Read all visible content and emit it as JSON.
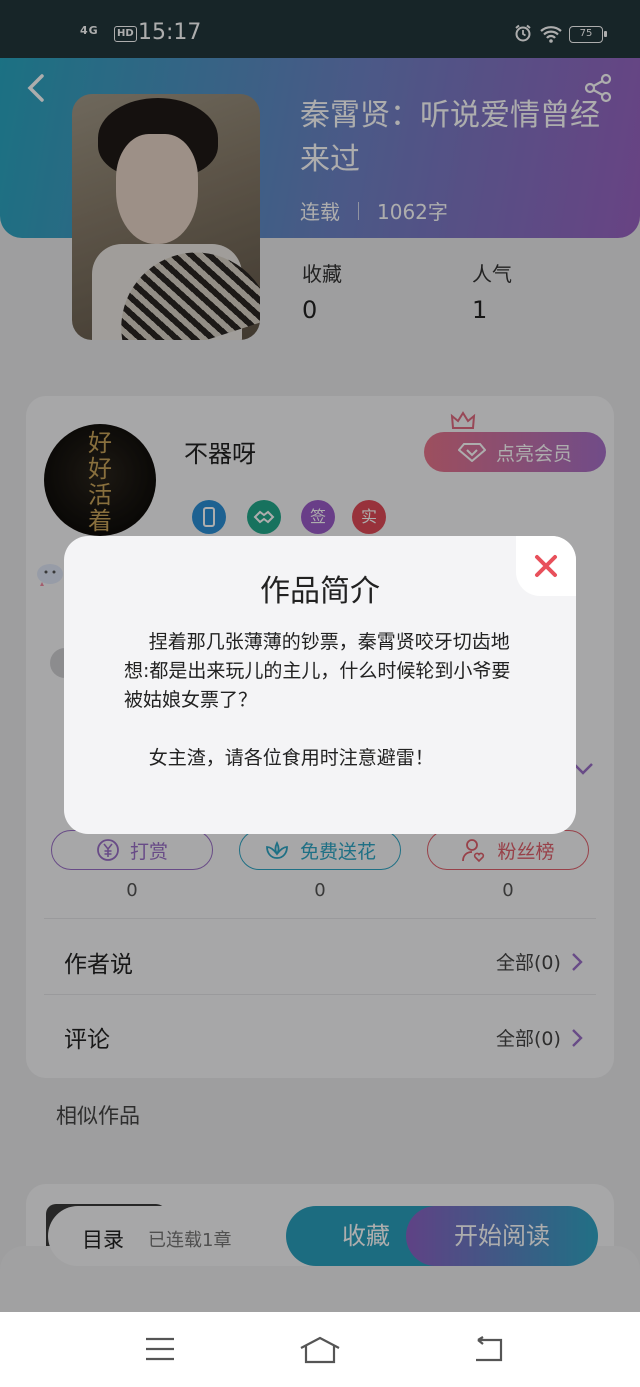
{
  "status_bar": {
    "network": "4G",
    "hd": "HD",
    "time": "15:17",
    "battery": "75"
  },
  "book": {
    "title": "秦霄贤：听说爱情曾经来过",
    "status": "连载",
    "word_count": "1062字",
    "stats": [
      {
        "label": "收藏",
        "value": "0"
      },
      {
        "label": "人气",
        "value": "1"
      }
    ]
  },
  "author": {
    "name": "不器呀",
    "avatar_text": "好好活着",
    "badges": [
      {
        "icon": "phone-badge-icon",
        "text": "",
        "color": "#2b8fd6"
      },
      {
        "icon": "handshake-badge-icon",
        "text": "",
        "color": "#23a98b"
      },
      {
        "icon": "sign-badge-icon",
        "text": "签",
        "color": "#9b5cc9"
      },
      {
        "icon": "real-badge-icon",
        "text": "实",
        "color": "#e04b57"
      }
    ],
    "vip_label": "点亮会员"
  },
  "actions": [
    {
      "label": "打赏",
      "count": "0",
      "color": "#9a6fc7"
    },
    {
      "label": "免费送花",
      "count": "0",
      "color": "#2ea5c4"
    },
    {
      "label": "粉丝榜",
      "count": "0",
      "color": "#e0606c"
    }
  ],
  "sections": {
    "author_says": {
      "label": "作者说",
      "link": "全部(0)"
    },
    "comments": {
      "label": "评论",
      "link": "全部(0)"
    }
  },
  "similar_title": "相似作品",
  "bottom_bar": {
    "menu_label": "目录",
    "serial_status": "已连载1章",
    "favorite_label": "收藏",
    "read_label": "开始阅读"
  },
  "modal": {
    "title": "作品简介",
    "paragraph_1": "捏着那几张薄薄的钞票，秦霄贤咬牙切齿地想:都是出来玩儿的主儿，什么时候轮到小爷要被姑娘女票了？",
    "paragraph_2": "女主渣，请各位食用时注意避雷！",
    "close_color": "#e8505b"
  }
}
